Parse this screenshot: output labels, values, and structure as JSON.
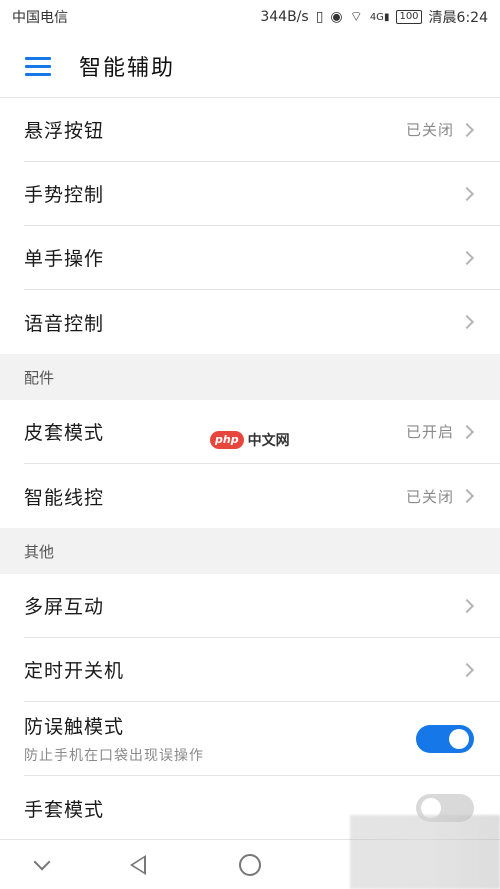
{
  "status_bar": {
    "carrier": "中国电信",
    "net_speed": "344B/s",
    "signal_label": "4G",
    "battery": "100",
    "time": "清晨6:24"
  },
  "app_bar": {
    "title": "智能辅助"
  },
  "group1": [
    {
      "label": "悬浮按钮",
      "value": "已关闭"
    },
    {
      "label": "手势控制",
      "value": ""
    },
    {
      "label": "单手操作",
      "value": ""
    },
    {
      "label": "语音控制",
      "value": ""
    }
  ],
  "section_accessories": {
    "header": "配件",
    "items": [
      {
        "label": "皮套模式",
        "value": "已开启"
      },
      {
        "label": "智能线控",
        "value": "已关闭"
      }
    ]
  },
  "section_other": {
    "header": "其他",
    "items": [
      {
        "label": "多屏互动"
      },
      {
        "label": "定时开关机"
      }
    ],
    "mistouch": {
      "label": "防误触模式",
      "subtitle": "防止手机在口袋出现误操作",
      "toggle_on": true
    },
    "glove": {
      "label": "手套模式",
      "toggle_on": false
    }
  },
  "watermark": {
    "badge": "php",
    "text": "中文网"
  },
  "colors": {
    "accent": "#1678e8",
    "toggle_off": "#d9d9d9"
  }
}
